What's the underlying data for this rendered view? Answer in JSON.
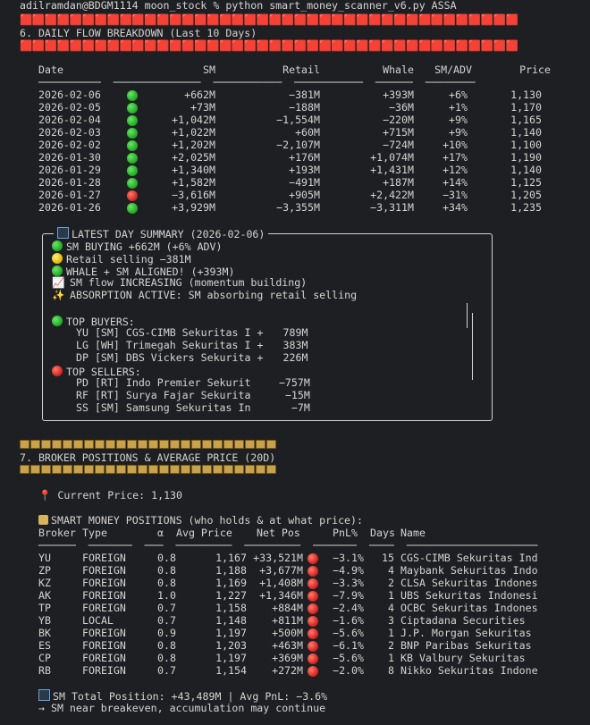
{
  "prompt": "adilramdan@BDGM1114 moon_stock % python smart_money_scanner_v6.py ASSA",
  "section6": {
    "title": "6. DAILY FLOW BREAKDOWN (Last 10 Days)",
    "headers": [
      "Date",
      "SM",
      "Retail",
      "Whale",
      "SM/ADV",
      "Price"
    ],
    "separator": "──────────  ──────────────  ───────────  ───────────  ──────  ────────",
    "rows": [
      {
        "date": "2026-02-06",
        "dot": "green",
        "sm": "+662M",
        "retail": "−381M",
        "whale": "+393M",
        "adv": "+6%",
        "price": "1,130"
      },
      {
        "date": "2026-02-05",
        "dot": "green",
        "sm": "+73M",
        "retail": "−188M",
        "whale": "−36M",
        "adv": "+1%",
        "price": "1,170"
      },
      {
        "date": "2026-02-04",
        "dot": "green",
        "sm": "+1,042M",
        "retail": "−1,554M",
        "whale": "−220M",
        "adv": "+9%",
        "price": "1,165"
      },
      {
        "date": "2026-02-03",
        "dot": "green",
        "sm": "+1,022M",
        "retail": "+60M",
        "whale": "+715M",
        "adv": "+9%",
        "price": "1,140"
      },
      {
        "date": "2026-02-02",
        "dot": "green",
        "sm": "+1,202M",
        "retail": "−2,107M",
        "whale": "−724M",
        "adv": "+10%",
        "price": "1,100"
      },
      {
        "date": "2026-01-30",
        "dot": "green",
        "sm": "+2,025M",
        "retail": "+176M",
        "whale": "+1,074M",
        "adv": "+17%",
        "price": "1,190"
      },
      {
        "date": "2026-01-29",
        "dot": "green",
        "sm": "+1,340M",
        "retail": "+193M",
        "whale": "+1,431M",
        "adv": "+12%",
        "price": "1,140"
      },
      {
        "date": "2026-01-28",
        "dot": "green",
        "sm": "+1,582M",
        "retail": "−491M",
        "whale": "+187M",
        "adv": "+14%",
        "price": "1,125"
      },
      {
        "date": "2026-01-27",
        "dot": "red",
        "sm": "−3,616M",
        "retail": "+905M",
        "whale": "+2,422M",
        "adv": "−31%",
        "price": "1,205"
      },
      {
        "date": "2026-01-26",
        "dot": "green",
        "sm": "+3,929M",
        "retail": "−3,355M",
        "whale": "−3,311M",
        "adv": "+34%",
        "price": "1,235"
      }
    ]
  },
  "summary": {
    "title": "LATEST DAY SUMMARY (2026-02-06)",
    "lines": [
      {
        "icon": "green",
        "text": "SM BUYING +662M (+6% ADV)"
      },
      {
        "icon": "yellow",
        "text": "Retail selling −381M"
      },
      {
        "icon": "green",
        "text": "WHALE + SM ALIGNED! (+393M)"
      },
      {
        "icon": "trend",
        "text": "SM flow INCREASING (momentum building)"
      },
      {
        "icon": "spark",
        "text": "ABSORPTION ACTIVE: SM absorbing retail selling"
      }
    ],
    "buyers_title": "TOP BUYERS:",
    "buyers": [
      {
        "code": "YU",
        "type": "[SM]",
        "name": "CGS-CIMB Sekuritas I",
        "sign": "+",
        "value": "789M"
      },
      {
        "code": "LG",
        "type": "[WH]",
        "name": "Trimegah Sekuritas I",
        "sign": "+",
        "value": "383M"
      },
      {
        "code": "DP",
        "type": "[SM]",
        "name": "DBS Vickers Sekurita",
        "sign": "+",
        "value": "226M"
      }
    ],
    "sellers_title": "TOP SELLERS:",
    "sellers": [
      {
        "code": "PD",
        "type": "[RT]",
        "name": "Indo Premier Sekurit",
        "value": "−757M"
      },
      {
        "code": "RF",
        "type": "[RT]",
        "name": "Surya Fajar Sekurita",
        "value": "−15M"
      },
      {
        "code": "SS",
        "type": "[SM]",
        "name": "Samsung Sekuritas In",
        "value": "−7M"
      }
    ]
  },
  "section7": {
    "title": "7. BROKER POSITIONS & AVERAGE PRICE (20D)",
    "current_price": "Current Price: 1,130",
    "positions_title": "SMART MONEY POSITIONS (who holds & at what price):",
    "headers": [
      "Broker",
      "Type",
      "α",
      "Avg Price",
      "Net Pos",
      "PnL%",
      "Days",
      "Name"
    ],
    "separator": "──────  ───────  ───  ─────────  ─────────  ───────  ────  ─────────────────────",
    "rows": [
      {
        "broker": "YU",
        "type": "FOREIGN",
        "alpha": "0.8",
        "avg": "1,167",
        "net": "+33,521M",
        "pnl": "−3.1%",
        "days": "15",
        "name": "CGS-CIMB Sekuritas Ind"
      },
      {
        "broker": "ZP",
        "type": "FOREIGN",
        "alpha": "0.8",
        "avg": "1,188",
        "net": "+3,677M",
        "pnl": "−4.9%",
        "days": "4",
        "name": "Maybank Sekuritas Indo"
      },
      {
        "broker": "KZ",
        "type": "FOREIGN",
        "alpha": "0.8",
        "avg": "1,169",
        "net": "+1,408M",
        "pnl": "−3.3%",
        "days": "2",
        "name": "CLSA Sekuritas Indones"
      },
      {
        "broker": "AK",
        "type": "FOREIGN",
        "alpha": "1.0",
        "avg": "1,227",
        "net": "+1,346M",
        "pnl": "−7.9%",
        "days": "1",
        "name": "UBS Sekuritas Indonesi"
      },
      {
        "broker": "TP",
        "type": "FOREIGN",
        "alpha": "0.7",
        "avg": "1,158",
        "net": "+884M",
        "pnl": "−2.4%",
        "days": "4",
        "name": "OCBC Sekuritas Indones"
      },
      {
        "broker": "YB",
        "type": "LOCAL",
        "alpha": "0.7",
        "avg": "1,148",
        "net": "+811M",
        "pnl": "−1.6%",
        "days": "3",
        "name": "Ciptadana Securities"
      },
      {
        "broker": "BK",
        "type": "FOREIGN",
        "alpha": "0.9",
        "avg": "1,197",
        "net": "+500M",
        "pnl": "−5.6%",
        "days": "1",
        "name": "J.P. Morgan Sekuritas"
      },
      {
        "broker": "ES",
        "type": "FOREIGN",
        "alpha": "0.8",
        "avg": "1,203",
        "net": "+463M",
        "pnl": "−6.1%",
        "days": "2",
        "name": "BNP Paribas Sekuritas"
      },
      {
        "broker": "CP",
        "type": "FOREIGN",
        "alpha": "0.8",
        "avg": "1,197",
        "net": "+369M",
        "pnl": "−5.6%",
        "days": "1",
        "name": "KB Valbury Sekuritas"
      },
      {
        "broker": "RB",
        "type": "FOREIGN",
        "alpha": "0.7",
        "avg": "1,154",
        "net": "+272M",
        "pnl": "−2.0%",
        "days": "8",
        "name": "Nikko Sekuritas Indone"
      }
    ],
    "total": "SM Total Position: +43,489M | Avg PnL: −3.6%",
    "note": "→ SM near breakeven, accumulation may continue"
  },
  "colors": {
    "background": "#1e1f22",
    "text": "#d4d4d4",
    "banner": "#e06c75",
    "green": "#1fa81f",
    "red": "#d21f1f"
  }
}
